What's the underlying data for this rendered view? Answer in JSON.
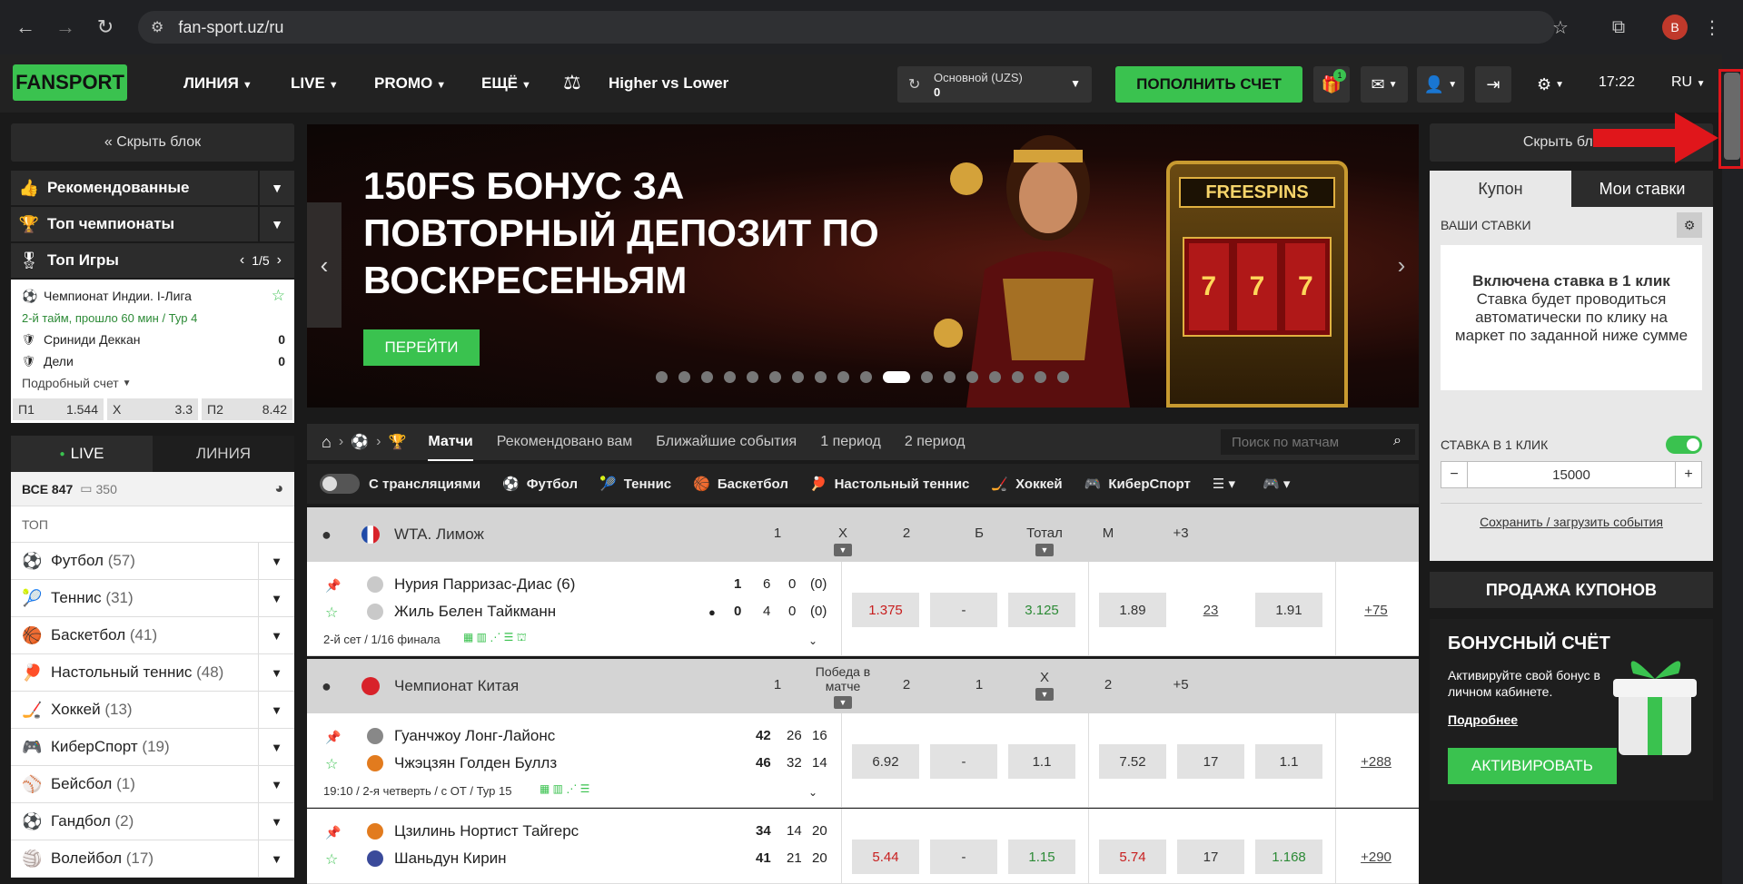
{
  "browser": {
    "url": "fan-sport.uz/ru",
    "profile_initial": "B"
  },
  "header": {
    "logo": "FANSPORT",
    "nav": [
      "ЛИНИЯ",
      "LIVE",
      "PROMO",
      "ЕЩЁ"
    ],
    "higher_lower": "Higher vs Lower",
    "balance_label": "Основной (UZS)",
    "balance_value": "0",
    "deposit": "ПОПОЛНИТЬ СЧЕТ",
    "gift_badge": "1",
    "time": "17:22",
    "lang": "RU"
  },
  "left": {
    "hide_block": "« Скрыть блок",
    "recommended": "Рекомендованные",
    "top_champs": "Топ чемпионаты",
    "top_games": "Топ Игры",
    "top_games_page": "1/5",
    "match": {
      "league": "Чемпионат Индии. I-Лига",
      "status": "2-й тайм, прошло 60 мин / Тур 4",
      "team1": "Сриниди Деккан",
      "score1": "0",
      "team2": "Дели",
      "score2": "0",
      "detail": "Подробный счет",
      "odds": [
        {
          "label": "П1",
          "value": "1.544"
        },
        {
          "label": "Х",
          "value": "3.3"
        },
        {
          "label": "П2",
          "value": "8.42"
        }
      ]
    },
    "tab_live": "LIVE",
    "tab_line": "ЛИНИЯ",
    "all_label": "ВСЕ 847",
    "all_video": "350",
    "top_label": "ТОП",
    "sports": [
      {
        "name": "Футбол",
        "count": "(57)",
        "icon": "⚽"
      },
      {
        "name": "Теннис",
        "count": "(31)",
        "icon": "🎾"
      },
      {
        "name": "Баскетбол",
        "count": "(41)",
        "icon": "🏀"
      },
      {
        "name": "Настольный теннис",
        "count": "(48)",
        "icon": "🏓"
      },
      {
        "name": "Хоккей",
        "count": "(13)",
        "icon": "🏒"
      },
      {
        "name": "КиберСпорт",
        "count": "(19)",
        "icon": "🎮"
      },
      {
        "name": "Бейсбол",
        "count": "(1)",
        "icon": "⚾"
      },
      {
        "name": "Гандбол",
        "count": "(2)",
        "icon": "⚽"
      },
      {
        "name": "Волейбол",
        "count": "(17)",
        "icon": "🏐"
      }
    ]
  },
  "banner": {
    "title": "150FS БОНУС ЗА ПОВТОРНЫЙ ДЕПОЗИТ ПО ВОСКРЕСЕНЬЯМ",
    "button": "ПЕРЕЙТИ",
    "slot_sign": "FREESPINS",
    "slot_symbol": "7"
  },
  "tabs": [
    "Матчи",
    "Рекомендовано вам",
    "Ближайшие события",
    "1 период",
    "2 период"
  ],
  "search_placeholder": "Поиск по матчам",
  "filter": {
    "streams": "С трансляциями",
    "sports": [
      "Футбол",
      "Теннис",
      "Баскетбол",
      "Настольный теннис",
      "Хоккей",
      "КиберСпорт"
    ]
  },
  "league1": {
    "name": "WTA. Лимож",
    "cols": [
      "1",
      "X",
      "2",
      "Б",
      "Тотал",
      "М",
      "+3"
    ]
  },
  "match1": {
    "team1": "Нурия Парризас-Диас (6)",
    "team2": "Жиль Белен Тайкманн",
    "s1": [
      "1",
      "6",
      "0",
      "(0)"
    ],
    "s2": [
      "0",
      "4",
      "0",
      "(0)"
    ],
    "info": "2-й сет / 1/16 финала",
    "odds": [
      "1.375",
      "-",
      "3.125",
      "1.89",
      "23",
      "1.91"
    ],
    "more": "+75"
  },
  "league2": {
    "name": "Чемпионат Китая",
    "cols": [
      "1",
      "Победа в матче",
      "2",
      "1",
      "X",
      "2",
      "+5"
    ]
  },
  "match2": {
    "team1": "Гуанчжоу Лонг-Лайонс",
    "team2": "Чжэцзян Голден Буллз",
    "s1": [
      "42",
      "26",
      "16"
    ],
    "s2": [
      "46",
      "32",
      "14"
    ],
    "info": "19:10 / 2-я четверть / с ОТ / Тур 15",
    "odds": [
      "6.92",
      "-",
      "1.1",
      "7.52",
      "17",
      "1.1"
    ],
    "more": "+288"
  },
  "match3": {
    "team1": "Цзилинь Нортист Тайгерс",
    "team2": "Шаньдун Кирин",
    "s1": [
      "34",
      "14",
      "20"
    ],
    "s2": [
      "41",
      "21",
      "20"
    ],
    "odds": [
      "5.44",
      "-",
      "1.15",
      "5.74",
      "17",
      "1.168"
    ],
    "more": "+290"
  },
  "right": {
    "hide_block": "Скрыть блок »",
    "coupon": "Купон",
    "my_bets": "Мои ставки",
    "your_bets": "ВАШИ СТАВКИ",
    "oneclick_title": "Включена ставка в 1 клик",
    "oneclick_text": "Ставка будет проводиться автоматически по клику на маркет по заданной ниже сумме",
    "oneclick_label": "СТАВКА В 1 КЛИК",
    "stake": "15000",
    "save_load": "Сохранить / загрузить события",
    "sell": "ПРОДАЖА КУПОНОВ",
    "bonus_title": "БОНУСНЫЙ СЧЁТ",
    "bonus_text": "Активируйте свой бонус в личном кабинете.",
    "bonus_more": "Подробнее",
    "activate": "АКТИВИРОВАТЬ"
  },
  "colors": {
    "accent": "#3ac24f",
    "annotation": "#e0161b"
  }
}
